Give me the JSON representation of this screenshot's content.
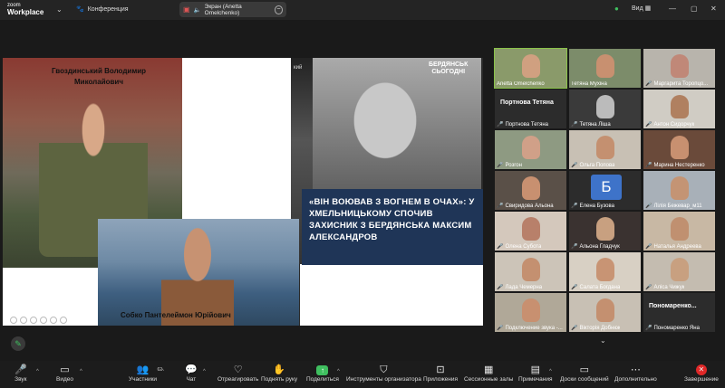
{
  "app": {
    "logo_line1": "zoom",
    "logo_line2": "Workplace",
    "meeting_label": "Конференция"
  },
  "share_pill": {
    "label": "Экран (Anetta Omelchenko)"
  },
  "top_right": {
    "view_label": "Вид"
  },
  "slide": {
    "name1": "Гвоздинський Володимир Миколайович",
    "name2": "Собко Пантелеймон Юрійович",
    "caption": "«ВІН ВОЮВАВ З ВОГНЕМ В ОЧАХ»: У ХМЕЛЬНИЦЬКОМУ СПОЧИВ ЗАХИСНИК З БЕРДЯНСЬКА МАКСИМ АЛЕКСАНДРОВ",
    "brand_line1": "БЕРДЯНСЬК",
    "brand_line2": "СЬОГОДНІ",
    "fragment": "кий"
  },
  "gallery": [
    {
      "label": "Anetta Omelchenko",
      "muted": false,
      "active": true,
      "kind": "photo",
      "bg": "#8a9a6a",
      "face": "#d0a080"
    },
    {
      "label": "Тетяна Мухіна",
      "muted": false,
      "active": false,
      "kind": "photo",
      "bg": "#7c8c6a",
      "face": "#c89070"
    },
    {
      "label": "Маргарита Торопцо...",
      "muted": true,
      "active": false,
      "kind": "photo",
      "bg": "#b8b4ac",
      "face": "#c08878"
    },
    {
      "label": "Портнова Тетяна",
      "muted": true,
      "active": false,
      "kind": "name",
      "bigname": "Портнова Тетяна"
    },
    {
      "label": "Тетяна Ліша",
      "muted": true,
      "active": false,
      "kind": "photo",
      "bg": "#3a3a3a",
      "face": "#bbbbbb"
    },
    {
      "label": "Антон Сидорчук",
      "muted": true,
      "active": false,
      "kind": "photo",
      "bg": "#d0ccc4",
      "face": "#b08060"
    },
    {
      "label": "Розгон",
      "muted": true,
      "active": false,
      "kind": "photo",
      "bg": "#8e9a82",
      "face": "#d0a088"
    },
    {
      "label": "Ольга Попова",
      "muted": true,
      "active": false,
      "kind": "photo",
      "bg": "#c8c0b4",
      "face": "#c49070"
    },
    {
      "label": "Марина Нестеренко",
      "muted": true,
      "active": false,
      "kind": "photo",
      "bg": "#6a4a3a",
      "face": "#c89070"
    },
    {
      "label": "Свиридова Альона",
      "muted": true,
      "active": false,
      "kind": "photo",
      "bg": "#5a5048",
      "face": "#c89070"
    },
    {
      "label": "Елена Бузова",
      "muted": true,
      "active": false,
      "kind": "avatar",
      "letter": "Б"
    },
    {
      "label": "Лілія Бежевар_м11",
      "muted": true,
      "active": false,
      "kind": "photo",
      "bg": "#a8b0b8",
      "face": "#c49474"
    },
    {
      "label": "Олена Субота",
      "muted": true,
      "active": false,
      "kind": "photo",
      "bg": "#d4c8bc",
      "face": "#b8806a"
    },
    {
      "label": "Альона Гладчук",
      "muted": true,
      "active": false,
      "kind": "photo",
      "bg": "#3a3230",
      "face": "#c8a080"
    },
    {
      "label": "Наталья Андреева",
      "muted": true,
      "active": false,
      "kind": "photo",
      "bg": "#c8b8a4",
      "face": "#c09070"
    },
    {
      "label": "Лада Чемерна",
      "muted": true,
      "active": false,
      "kind": "photo",
      "bg": "#ccc4b8",
      "face": "#c49070"
    },
    {
      "label": "Салата Богдана",
      "muted": true,
      "active": false,
      "kind": "photo",
      "bg": "#d8d0c4",
      "face": "#c89474"
    },
    {
      "label": "Аліса Чижук",
      "muted": true,
      "active": false,
      "kind": "photo",
      "bg": "#c4bcb0",
      "face": "#c8a080"
    },
    {
      "label": "Подключение звука -...",
      "muted": true,
      "active": false,
      "kind": "photo",
      "bg": "#b0a898",
      "face": "#c89070"
    },
    {
      "label": "Вікторія Добнюк",
      "muted": true,
      "active": false,
      "kind": "photo",
      "bg": "#c8c0b4",
      "face": "#c49070"
    },
    {
      "label": "Пономаренко Яна",
      "muted": true,
      "active": false,
      "kind": "name",
      "bigname": "Пономаренко..."
    }
  ],
  "toolbar": {
    "mute": "Звук",
    "video": "Видео",
    "participants": "Участники",
    "participants_count": "62",
    "chat": "Чат",
    "react": "Отреагировать",
    "raise": "Поднять руку",
    "share": "Поделиться",
    "host_tools": "Инструменты организатора",
    "apps": "Приложения",
    "rooms": "Сессионные залы",
    "notes": "Примечания",
    "docs": "Доски сообщений",
    "more": "Дополнительно",
    "end": "Завершение"
  }
}
